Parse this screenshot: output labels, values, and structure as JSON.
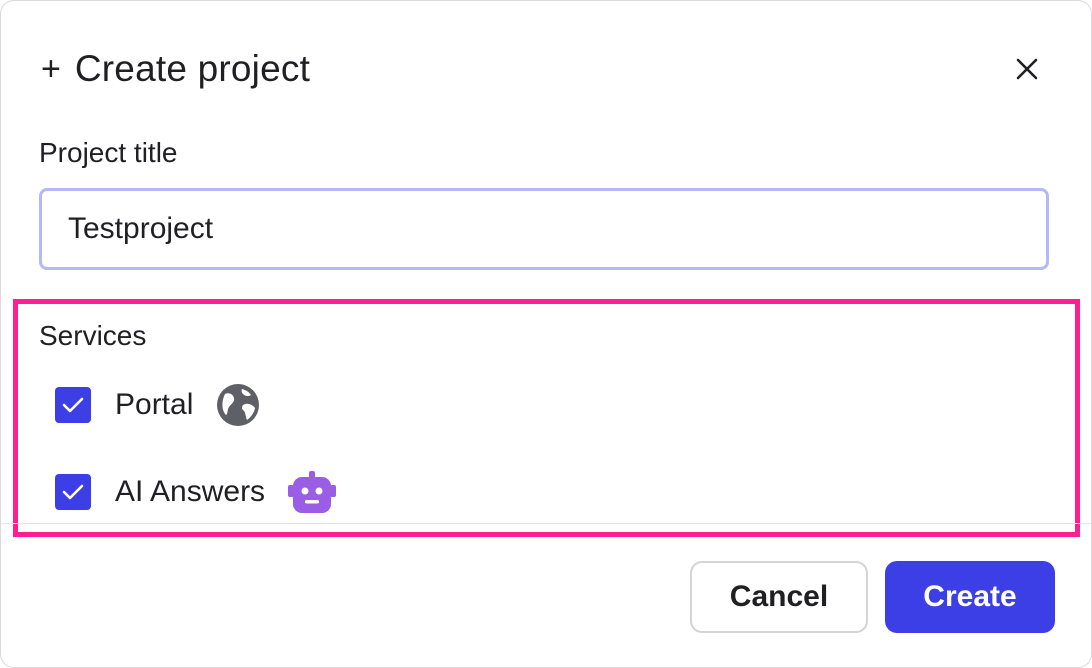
{
  "dialog": {
    "title": "Create project",
    "plus_glyph": "+",
    "close_icon": "close-icon"
  },
  "form": {
    "title_label": "Project title",
    "title_value": "Testproject"
  },
  "services": {
    "label": "Services",
    "items": [
      {
        "label": "Portal",
        "checked": true,
        "icon": "globe-icon",
        "icon_color": "#5f5f66"
      },
      {
        "label": "AI Answers",
        "checked": true,
        "icon": "robot-icon",
        "icon_color": "#9b5de5"
      }
    ]
  },
  "footer": {
    "cancel_label": "Cancel",
    "create_label": "Create"
  },
  "colors": {
    "accent": "#3c3fe6",
    "highlight_border": "#ff1f93",
    "input_border": "#b4b8f5"
  }
}
